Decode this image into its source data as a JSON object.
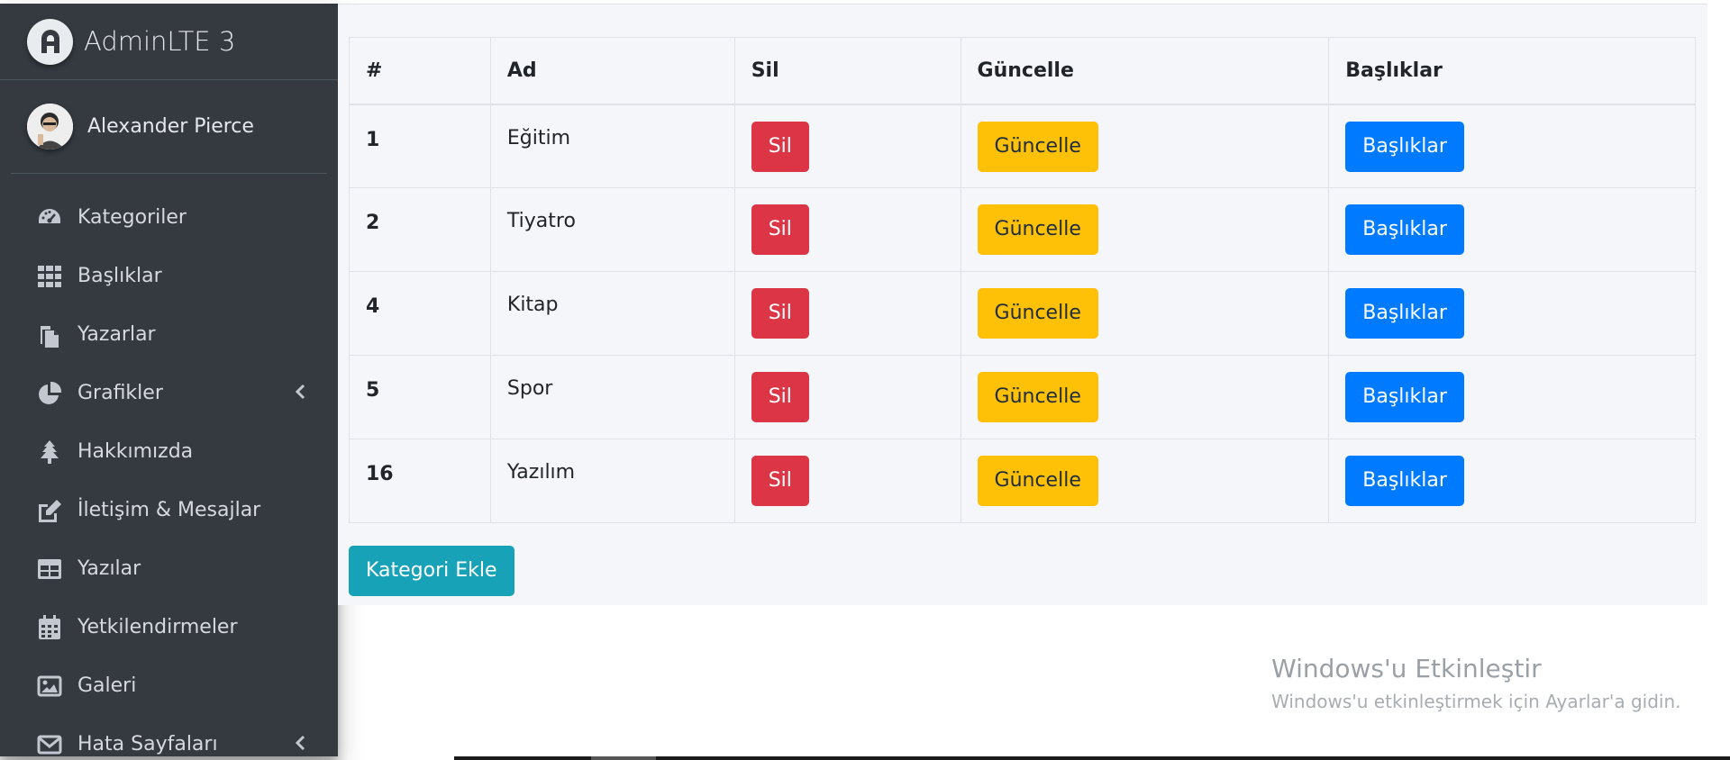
{
  "brand": {
    "title": "AdminLTE 3"
  },
  "user": {
    "name": "Alexander Pierce"
  },
  "sidebar": {
    "items": [
      {
        "label": "Kategoriler",
        "icon": "tachometer-icon"
      },
      {
        "label": "Başlıklar",
        "icon": "grid-icon"
      },
      {
        "label": "Yazarlar",
        "icon": "copy-icon"
      },
      {
        "label": "Grafikler",
        "icon": "pie-chart-icon",
        "has_arrow": true
      },
      {
        "label": "Hakkımızda",
        "icon": "tree-icon"
      },
      {
        "label": "İletişim & Mesajlar",
        "icon": "edit-icon"
      },
      {
        "label": "Yazılar",
        "icon": "table-icon"
      },
      {
        "label": "Yetkilendirmeler",
        "icon": "calendar-icon"
      },
      {
        "label": "Galeri",
        "icon": "image-icon"
      },
      {
        "label": "Hata Sayfaları",
        "icon": "envelope-icon",
        "has_arrow": true
      }
    ]
  },
  "table": {
    "headers": [
      "#",
      "Ad",
      "Sil",
      "Güncelle",
      "Başlıklar"
    ],
    "rows": [
      {
        "id": "1",
        "name": "Eğitim"
      },
      {
        "id": "2",
        "name": "Tiyatro"
      },
      {
        "id": "4",
        "name": "Kitap"
      },
      {
        "id": "5",
        "name": "Spor"
      },
      {
        "id": "16",
        "name": "Yazılım"
      }
    ],
    "delete_label": "Sil",
    "update_label": "Güncelle",
    "titles_label": "Başlıklar"
  },
  "actions": {
    "add_category": "Kategori Ekle"
  },
  "watermark": {
    "title": "Windows'u Etkinleştir",
    "subtitle": "Windows'u etkinleştirmek için Ayarlar'a gidin."
  },
  "colors": {
    "sidebar_bg": "#343a40",
    "danger": "#dc3545",
    "warning": "#ffc107",
    "primary": "#007bff",
    "info": "#17a2b8"
  }
}
